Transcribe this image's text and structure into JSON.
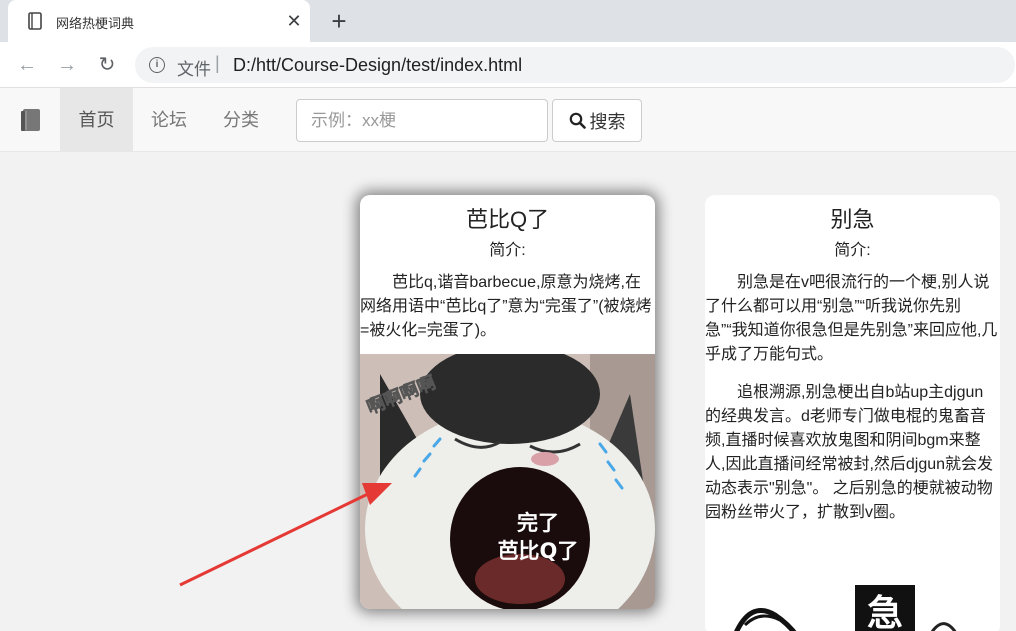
{
  "browser": {
    "tab_title": "网络热梗词典",
    "tab_close": "✕",
    "new_tab": "+",
    "back": "←",
    "forward": "→",
    "reload": "↻",
    "url_label": "文件",
    "url_sep": "|",
    "url": "D:/htt/Course-Design/test/index.html"
  },
  "nav": {
    "home": "首页",
    "forum": "论坛",
    "category": "分类",
    "search_placeholder": "示例：xx梗",
    "search_button": "搜索"
  },
  "cards": [
    {
      "title": "芭比Q了",
      "subtitle": "简介:",
      "paragraphs": [
        "芭比q,谐音barbecue,原意为烧烤,在网络用语中“芭比q了”意为“完蛋了”(被烧烤=被火化=完蛋了)。"
      ],
      "image_text_top": "啊啊啊啊",
      "image_text_line1": "完了",
      "image_text_line2": "芭比Q了"
    },
    {
      "title": "别急",
      "subtitle": "简介:",
      "paragraphs": [
        "别急是在v吧很流行的一个梗,别人说了什么都可以用“别急”“听我说你先别急”“我知道你很急但是先别急”来回应他,几乎成了万能句式。",
        "追根溯源,别急梗出自b站up主djgun的经典发言。d老师专门做电棍的鬼畜音频,直播时候喜欢放鬼图和阴间bgm来整人,因此直播间经常被封,然后djgun就会发动态表示\"别急\"。 之后别急的梗就被动物园粉丝带火了，扩散到v圈。"
      ],
      "image_text": "急"
    }
  ],
  "colors": {
    "arrow": "#e53935",
    "nav_active_bg": "#e7e7e7"
  }
}
